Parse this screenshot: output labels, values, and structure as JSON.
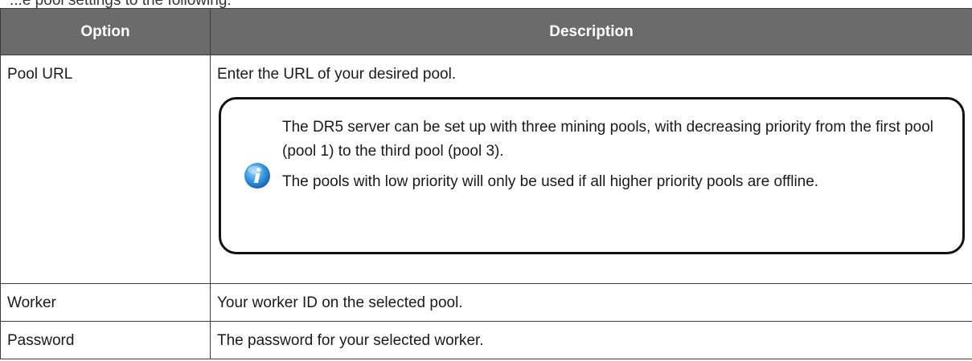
{
  "intro_fragment": "...e pool settings to the following:",
  "table": {
    "headers": {
      "option": "Option",
      "description": "Description"
    },
    "rows": [
      {
        "option": "Pool URL",
        "description": "Enter the URL of your desired pool."
      },
      {
        "option": "Worker",
        "description": "Your worker ID on the selected pool."
      },
      {
        "option": "Password",
        "description": "The password for your selected worker."
      }
    ]
  },
  "note": {
    "icon": "info-icon",
    "paragraph_1": "The DR5 server can be set up with three mining pools, with decreasing priority from the first pool (pool 1) to the third pool (pool 3).",
    "paragraph_2": "The pools with low priority will only be used if all higher priority pools are offline."
  },
  "colors": {
    "header_bg": "#6b6b6b",
    "header_text": "#ffffff",
    "border": "#3c3c3c",
    "icon_blue": "#2f8fd6"
  }
}
